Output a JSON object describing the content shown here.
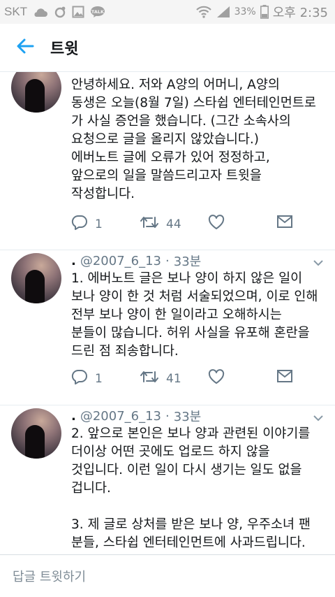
{
  "status_bar": {
    "carrier": "SKT",
    "battery": "33%",
    "time": "오후 2:35",
    "icons": [
      "cloud-icon",
      "sync-icon",
      "image-icon",
      "talk-icon",
      "wifi-icon",
      "signal-icon",
      "battery-icon"
    ]
  },
  "header": {
    "title": "트윗"
  },
  "tweets": [
    {
      "text": "안녕하세요. 저와 A양의 어머니, A양의\n동생은 오늘(8월 7일) 스타쉽 엔터테인먼트로\n가 사실 증언을 했습니다. (그간 소속사의\n요청으로 글을 올리지 않았습니다.)\n에버노트 글에 오류가 있어 정정하고,\n앞으로의 일을 말씀드리고자 트윗을\n작성합니다.",
      "replies": "1",
      "retweets": "44"
    },
    {
      "name": ".",
      "handle": "@2007_6_13",
      "dot": "·",
      "time": "33분",
      "text": "1. 에버노트 글은 보나 양이 하지 않은 일이\n보나 양이 한 것 처럼 서술되었으며, 이로 인해\n전부 보나 양이 한 일이라고 오해하시는\n분들이 많습니다. 허위 사실을 유포해 혼란을\n드린 점 죄송합니다.",
      "replies": "1",
      "retweets": "41"
    },
    {
      "name": ".",
      "handle": "@2007_6_13",
      "dot": "·",
      "time": "33분",
      "text": "2. 앞으로 본인은 보나 양과 관련된 이야기를\n더이상 어떤 곳에도 업로드 하지 않을\n것입니다. 이런 일이 다시 생기는 일도 없을\n겁니다.\n\n3. 제 글로 상처를 받은 보나 양, 우주소녀 팬\n분들, 스타쉽 엔터테인먼트에 사과드립니다."
    }
  ],
  "reply_bar": {
    "placeholder": "답글 트윗하기"
  },
  "colors": {
    "accent": "#1da1f2",
    "secondary_text": "#657786",
    "divider": "#e6ecf0"
  }
}
